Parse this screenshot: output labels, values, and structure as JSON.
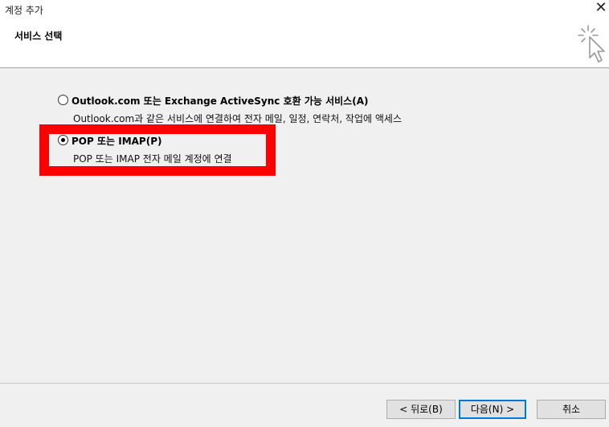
{
  "window": {
    "title": "계정 추가",
    "close_label": "✕"
  },
  "header": {
    "page_title": "서비스 선택"
  },
  "options": [
    {
      "label": "Outlook.com 또는 Exchange ActiveSync 호환 가능 서비스(A)",
      "description": "Outlook.com과 같은 서비스에 연결하여 전자 메일, 일정, 연락처, 작업에 액세스",
      "selected": false
    },
    {
      "label": "POP 또는 IMAP(P)",
      "description": "POP 또는 IMAP 전자 메일 계정에 연결",
      "selected": true
    }
  ],
  "highlight_color": "#ff0000",
  "buttons": {
    "back": "< 뒤로(B)",
    "next": "다음(N) >",
    "cancel": "취소"
  }
}
